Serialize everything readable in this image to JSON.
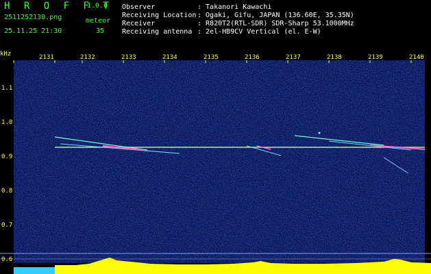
{
  "header": {
    "app_title": "H R O F F T",
    "app_version": "1.0.0",
    "file_name": "2511252130.png",
    "meteor_label": "meteor",
    "date_time": "25.11.25 21:30",
    "meteor_count": "35",
    "info": [
      {
        "key": "Observer",
        "value": ": Takanori Kawachi"
      },
      {
        "key": "Receiving Location",
        "value": ": Ogaki, Gifu, JAPAN (136.60E, 35.35N)"
      },
      {
        "key": "Receiver",
        "value": ": R820T2(RTL-SDR) SDR-Sharp 53.1000MHz"
      },
      {
        "key": "Receiving antenna",
        "value": ": 2el-HB9CV Vertical (el. E-W)"
      }
    ]
  },
  "axis": {
    "y_unit": "kHz",
    "y_ticks": [
      "1.1",
      "1.0",
      "0.9",
      "0.8",
      "0.7",
      "0.6"
    ],
    "x_ticks": [
      "2131",
      "2132",
      "2133",
      "2134",
      "2135",
      "2136",
      "2137",
      "2138",
      "2139",
      "2140"
    ]
  },
  "colors": {
    "background": "#000000",
    "header_text": "#33ff33",
    "info_text": "#ffffff",
    "axis_text": "#ffff44",
    "waterfall": "#0a1a6a",
    "signal_line": "#aaff66",
    "meteor_echo": "#ff66cc",
    "noise_bar": "#ffff00",
    "noise_low": "#33ccff"
  }
}
